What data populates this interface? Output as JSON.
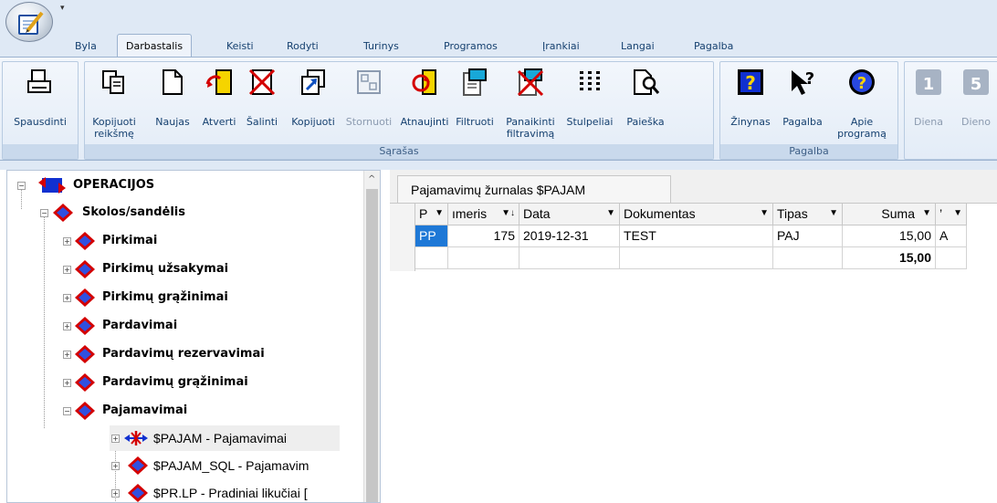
{
  "ribbon_tabs": [
    "Byla",
    "Darbastalis",
    "Keisti",
    "Rodyti",
    "Turinys",
    "Programos",
    "Įrankiai",
    "Langai",
    "Pagalba"
  ],
  "groups": {
    "print": "",
    "list": "Sąrašas",
    "help": "Pagalba"
  },
  "buttons": {
    "print": "Spausdinti",
    "copy_value_1": "Kopijuoti",
    "copy_value_2": "reikšmę",
    "new": "Naujas",
    "open": "Atverti",
    "delete": "Šalinti",
    "copy": "Kopijuoti",
    "reverse": "Stornuoti",
    "refresh": "Atnaujinti",
    "filter": "Filtruoti",
    "unfilter_1": "Panaikinti",
    "unfilter_2": "filtravimą",
    "columns": "Stulpeliai",
    "search": "Paieška",
    "directories": "Žinynas",
    "help": "Pagalba",
    "about_1": "Apie",
    "about_2": "programą",
    "day_num": "1",
    "day": "Diena",
    "days_num": "5",
    "days": "Dieno"
  },
  "tree": {
    "root": "OPERACIJOS",
    "debts": "Skolos/sandėlis",
    "items": [
      "Pirkimai",
      "Pirkimų užsakymai",
      "Pirkimų grąžinimai",
      "Pardavimai",
      "Pardavimų rezervavimai",
      "Pardavimų grąžinimai",
      "Pajamavimai"
    ],
    "sub": [
      "$PAJAM - Pajamavimai",
      "$PAJAM_SQL - Pajamavim",
      "$PR.LP - Pradiniai likučiai ["
    ]
  },
  "journal": {
    "title": "Pajamavimų žurnalas $PAJAM",
    "headers": [
      "P",
      "ımeris",
      "Data",
      "Dokumentas",
      "Tipas",
      "Suma",
      "’"
    ],
    "row": [
      "PP",
      "175",
      "2019-12-31",
      "TEST",
      "PAJ",
      "15,00",
      "A"
    ],
    "total": "15,00"
  },
  "colors": {
    "ribbon_bg": "#e3ecf7",
    "accent": "#15406f",
    "selection": "#1e78d6"
  }
}
